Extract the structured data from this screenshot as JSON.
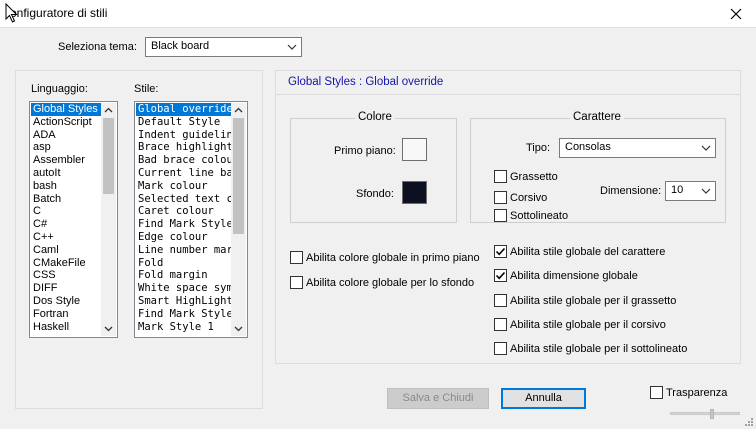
{
  "window": {
    "title": "onfiguratore di stili"
  },
  "theme": {
    "label": "Seleziona tema:",
    "value": "Black board"
  },
  "language": {
    "label": "Linguaggio:",
    "items": [
      "Global Styles",
      "ActionScript",
      "ADA",
      "asp",
      "Assembler",
      "autoIt",
      "bash",
      "Batch",
      "C",
      "C#",
      "C++",
      "Caml",
      "CMakeFile",
      "CSS",
      "DIFF",
      "Dos Style",
      "Fortran",
      "Haskell"
    ],
    "selected_index": 0
  },
  "style": {
    "label": "Stile:",
    "items": [
      "Global override",
      "Default Style",
      "Indent guideline style",
      "Brace highlight style",
      "Bad brace colour",
      "Current line background colour",
      "Mark colour",
      "Selected text colour",
      "Caret colour",
      "Find Mark Style",
      "Edge colour",
      "Line number margin",
      "Fold",
      "Fold margin",
      "White space symbol",
      "Smart HighLighting",
      "Find Mark Style",
      "Mark Style 1"
    ],
    "selected_index": 0
  },
  "panel": {
    "title": "Global Styles : Global override"
  },
  "colore": {
    "legend": "Colore",
    "foreground_label": "Primo piano:",
    "background_label": "Sfondo:",
    "foreground_color": "#f8f8f8",
    "background_color": "#0c1021"
  },
  "carattere": {
    "legend": "Carattere",
    "type_label": "Tipo:",
    "type_value": "Consolas",
    "size_label": "Dimensione:",
    "size_value": "10",
    "bold_label": "Grassetto",
    "bold_checked": false,
    "italic_label": "Corsivo",
    "italic_checked": false,
    "underline_label": "Sottolineato",
    "underline_checked": false
  },
  "global_options_left": [
    {
      "label": "Abilita colore globale in primo piano",
      "checked": false
    },
    {
      "label": "Abilita colore globale per lo sfondo",
      "checked": false
    }
  ],
  "global_options_right": [
    {
      "label": "Abilita stile globale del carattere",
      "checked": true
    },
    {
      "label": "Abilita dimensione globale",
      "checked": true
    },
    {
      "label": "Abilita stile globale per il grassetto",
      "checked": false
    },
    {
      "label": "Abilita stile globale per il corsivo",
      "checked": false
    },
    {
      "label": "Abilita stile globale per il sottolineato",
      "checked": false
    }
  ],
  "buttons": {
    "save_label": "Salva e Chiudi",
    "cancel_label": "Annulla"
  },
  "transparency": {
    "label": "Trasparenza",
    "checked": false,
    "level": 0.6
  },
  "icons": {
    "close": "close-icon",
    "cursor": "cursor-icon",
    "dropdown": "chevron-down-icon",
    "scroll_up": "scroll-up-icon",
    "scroll_down": "scroll-down-icon",
    "grip": "resize-grip-icon"
  },
  "colors": {
    "accent": "#0078d7",
    "panel_title": "#1515a8"
  }
}
